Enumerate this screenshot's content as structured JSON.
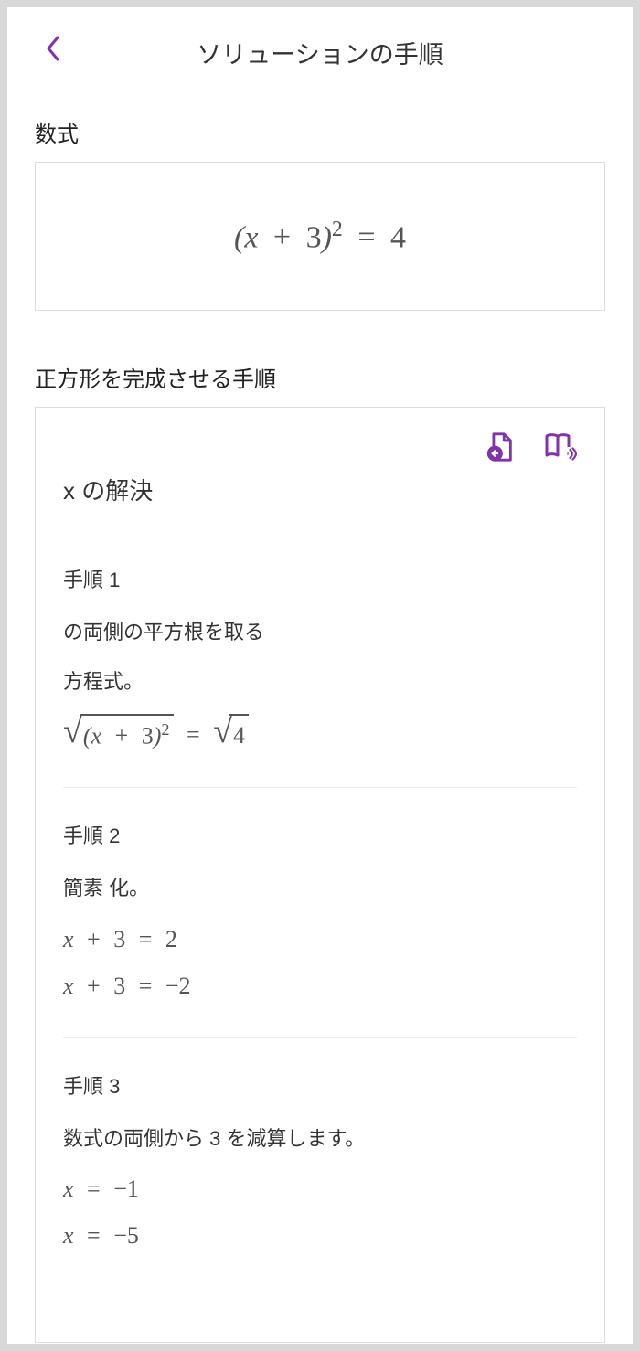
{
  "header": {
    "title": "ソリューションの手順"
  },
  "equation_section": {
    "label": "数式",
    "equation_display": "(x + 3)² = 4"
  },
  "steps_section": {
    "label": "正方形を完成させる手順",
    "solve_title": "x の解決",
    "steps": [
      {
        "num": "手順 1",
        "desc_line1": "の両側の平方根を取る",
        "desc_line2": "方程式。",
        "math": "√((x+3)²) = √4"
      },
      {
        "num": "手順 2",
        "desc_line1": "簡素 化。",
        "math1": "x + 3 = 2",
        "math2": "x + 3 = −2"
      },
      {
        "num": "手順 3",
        "desc_line1": "数式の両側から 3 を減算します。",
        "math1": "x = −1",
        "math2": "x = −5"
      }
    ]
  }
}
